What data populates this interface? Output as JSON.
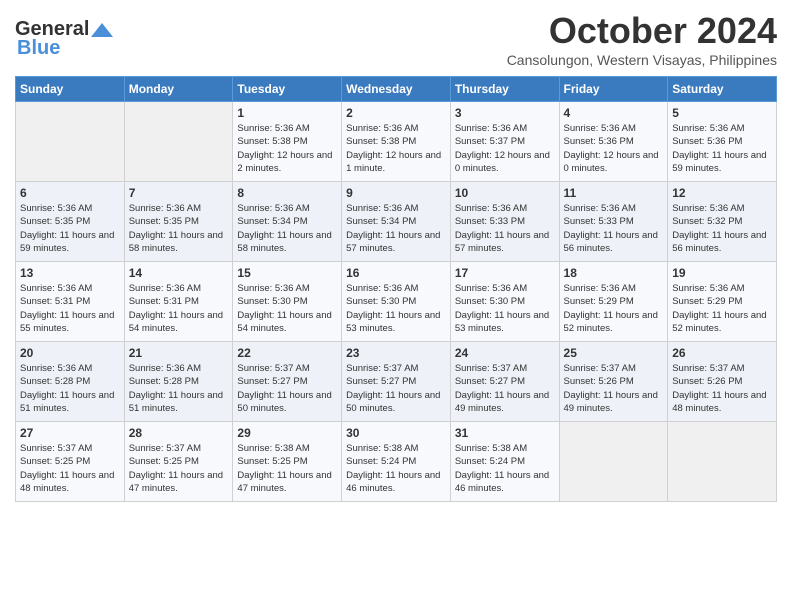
{
  "logo": {
    "general": "General",
    "blue": "Blue"
  },
  "title": "October 2024",
  "location": "Cansolungon, Western Visayas, Philippines",
  "headers": [
    "Sunday",
    "Monday",
    "Tuesday",
    "Wednesday",
    "Thursday",
    "Friday",
    "Saturday"
  ],
  "weeks": [
    [
      {
        "day": "",
        "sunrise": "",
        "sunset": "",
        "daylight": ""
      },
      {
        "day": "",
        "sunrise": "",
        "sunset": "",
        "daylight": ""
      },
      {
        "day": "1",
        "sunrise": "Sunrise: 5:36 AM",
        "sunset": "Sunset: 5:38 PM",
        "daylight": "Daylight: 12 hours and 2 minutes."
      },
      {
        "day": "2",
        "sunrise": "Sunrise: 5:36 AM",
        "sunset": "Sunset: 5:38 PM",
        "daylight": "Daylight: 12 hours and 1 minute."
      },
      {
        "day": "3",
        "sunrise": "Sunrise: 5:36 AM",
        "sunset": "Sunset: 5:37 PM",
        "daylight": "Daylight: 12 hours and 0 minutes."
      },
      {
        "day": "4",
        "sunrise": "Sunrise: 5:36 AM",
        "sunset": "Sunset: 5:36 PM",
        "daylight": "Daylight: 12 hours and 0 minutes."
      },
      {
        "day": "5",
        "sunrise": "Sunrise: 5:36 AM",
        "sunset": "Sunset: 5:36 PM",
        "daylight": "Daylight: 11 hours and 59 minutes."
      }
    ],
    [
      {
        "day": "6",
        "sunrise": "Sunrise: 5:36 AM",
        "sunset": "Sunset: 5:35 PM",
        "daylight": "Daylight: 11 hours and 59 minutes."
      },
      {
        "day": "7",
        "sunrise": "Sunrise: 5:36 AM",
        "sunset": "Sunset: 5:35 PM",
        "daylight": "Daylight: 11 hours and 58 minutes."
      },
      {
        "day": "8",
        "sunrise": "Sunrise: 5:36 AM",
        "sunset": "Sunset: 5:34 PM",
        "daylight": "Daylight: 11 hours and 58 minutes."
      },
      {
        "day": "9",
        "sunrise": "Sunrise: 5:36 AM",
        "sunset": "Sunset: 5:34 PM",
        "daylight": "Daylight: 11 hours and 57 minutes."
      },
      {
        "day": "10",
        "sunrise": "Sunrise: 5:36 AM",
        "sunset": "Sunset: 5:33 PM",
        "daylight": "Daylight: 11 hours and 57 minutes."
      },
      {
        "day": "11",
        "sunrise": "Sunrise: 5:36 AM",
        "sunset": "Sunset: 5:33 PM",
        "daylight": "Daylight: 11 hours and 56 minutes."
      },
      {
        "day": "12",
        "sunrise": "Sunrise: 5:36 AM",
        "sunset": "Sunset: 5:32 PM",
        "daylight": "Daylight: 11 hours and 56 minutes."
      }
    ],
    [
      {
        "day": "13",
        "sunrise": "Sunrise: 5:36 AM",
        "sunset": "Sunset: 5:31 PM",
        "daylight": "Daylight: 11 hours and 55 minutes."
      },
      {
        "day": "14",
        "sunrise": "Sunrise: 5:36 AM",
        "sunset": "Sunset: 5:31 PM",
        "daylight": "Daylight: 11 hours and 54 minutes."
      },
      {
        "day": "15",
        "sunrise": "Sunrise: 5:36 AM",
        "sunset": "Sunset: 5:30 PM",
        "daylight": "Daylight: 11 hours and 54 minutes."
      },
      {
        "day": "16",
        "sunrise": "Sunrise: 5:36 AM",
        "sunset": "Sunset: 5:30 PM",
        "daylight": "Daylight: 11 hours and 53 minutes."
      },
      {
        "day": "17",
        "sunrise": "Sunrise: 5:36 AM",
        "sunset": "Sunset: 5:30 PM",
        "daylight": "Daylight: 11 hours and 53 minutes."
      },
      {
        "day": "18",
        "sunrise": "Sunrise: 5:36 AM",
        "sunset": "Sunset: 5:29 PM",
        "daylight": "Daylight: 11 hours and 52 minutes."
      },
      {
        "day": "19",
        "sunrise": "Sunrise: 5:36 AM",
        "sunset": "Sunset: 5:29 PM",
        "daylight": "Daylight: 11 hours and 52 minutes."
      }
    ],
    [
      {
        "day": "20",
        "sunrise": "Sunrise: 5:36 AM",
        "sunset": "Sunset: 5:28 PM",
        "daylight": "Daylight: 11 hours and 51 minutes."
      },
      {
        "day": "21",
        "sunrise": "Sunrise: 5:36 AM",
        "sunset": "Sunset: 5:28 PM",
        "daylight": "Daylight: 11 hours and 51 minutes."
      },
      {
        "day": "22",
        "sunrise": "Sunrise: 5:37 AM",
        "sunset": "Sunset: 5:27 PM",
        "daylight": "Daylight: 11 hours and 50 minutes."
      },
      {
        "day": "23",
        "sunrise": "Sunrise: 5:37 AM",
        "sunset": "Sunset: 5:27 PM",
        "daylight": "Daylight: 11 hours and 50 minutes."
      },
      {
        "day": "24",
        "sunrise": "Sunrise: 5:37 AM",
        "sunset": "Sunset: 5:27 PM",
        "daylight": "Daylight: 11 hours and 49 minutes."
      },
      {
        "day": "25",
        "sunrise": "Sunrise: 5:37 AM",
        "sunset": "Sunset: 5:26 PM",
        "daylight": "Daylight: 11 hours and 49 minutes."
      },
      {
        "day": "26",
        "sunrise": "Sunrise: 5:37 AM",
        "sunset": "Sunset: 5:26 PM",
        "daylight": "Daylight: 11 hours and 48 minutes."
      }
    ],
    [
      {
        "day": "27",
        "sunrise": "Sunrise: 5:37 AM",
        "sunset": "Sunset: 5:25 PM",
        "daylight": "Daylight: 11 hours and 48 minutes."
      },
      {
        "day": "28",
        "sunrise": "Sunrise: 5:37 AM",
        "sunset": "Sunset: 5:25 PM",
        "daylight": "Daylight: 11 hours and 47 minutes."
      },
      {
        "day": "29",
        "sunrise": "Sunrise: 5:38 AM",
        "sunset": "Sunset: 5:25 PM",
        "daylight": "Daylight: 11 hours and 47 minutes."
      },
      {
        "day": "30",
        "sunrise": "Sunrise: 5:38 AM",
        "sunset": "Sunset: 5:24 PM",
        "daylight": "Daylight: 11 hours and 46 minutes."
      },
      {
        "day": "31",
        "sunrise": "Sunrise: 5:38 AM",
        "sunset": "Sunset: 5:24 PM",
        "daylight": "Daylight: 11 hours and 46 minutes."
      },
      {
        "day": "",
        "sunrise": "",
        "sunset": "",
        "daylight": ""
      },
      {
        "day": "",
        "sunrise": "",
        "sunset": "",
        "daylight": ""
      }
    ]
  ]
}
